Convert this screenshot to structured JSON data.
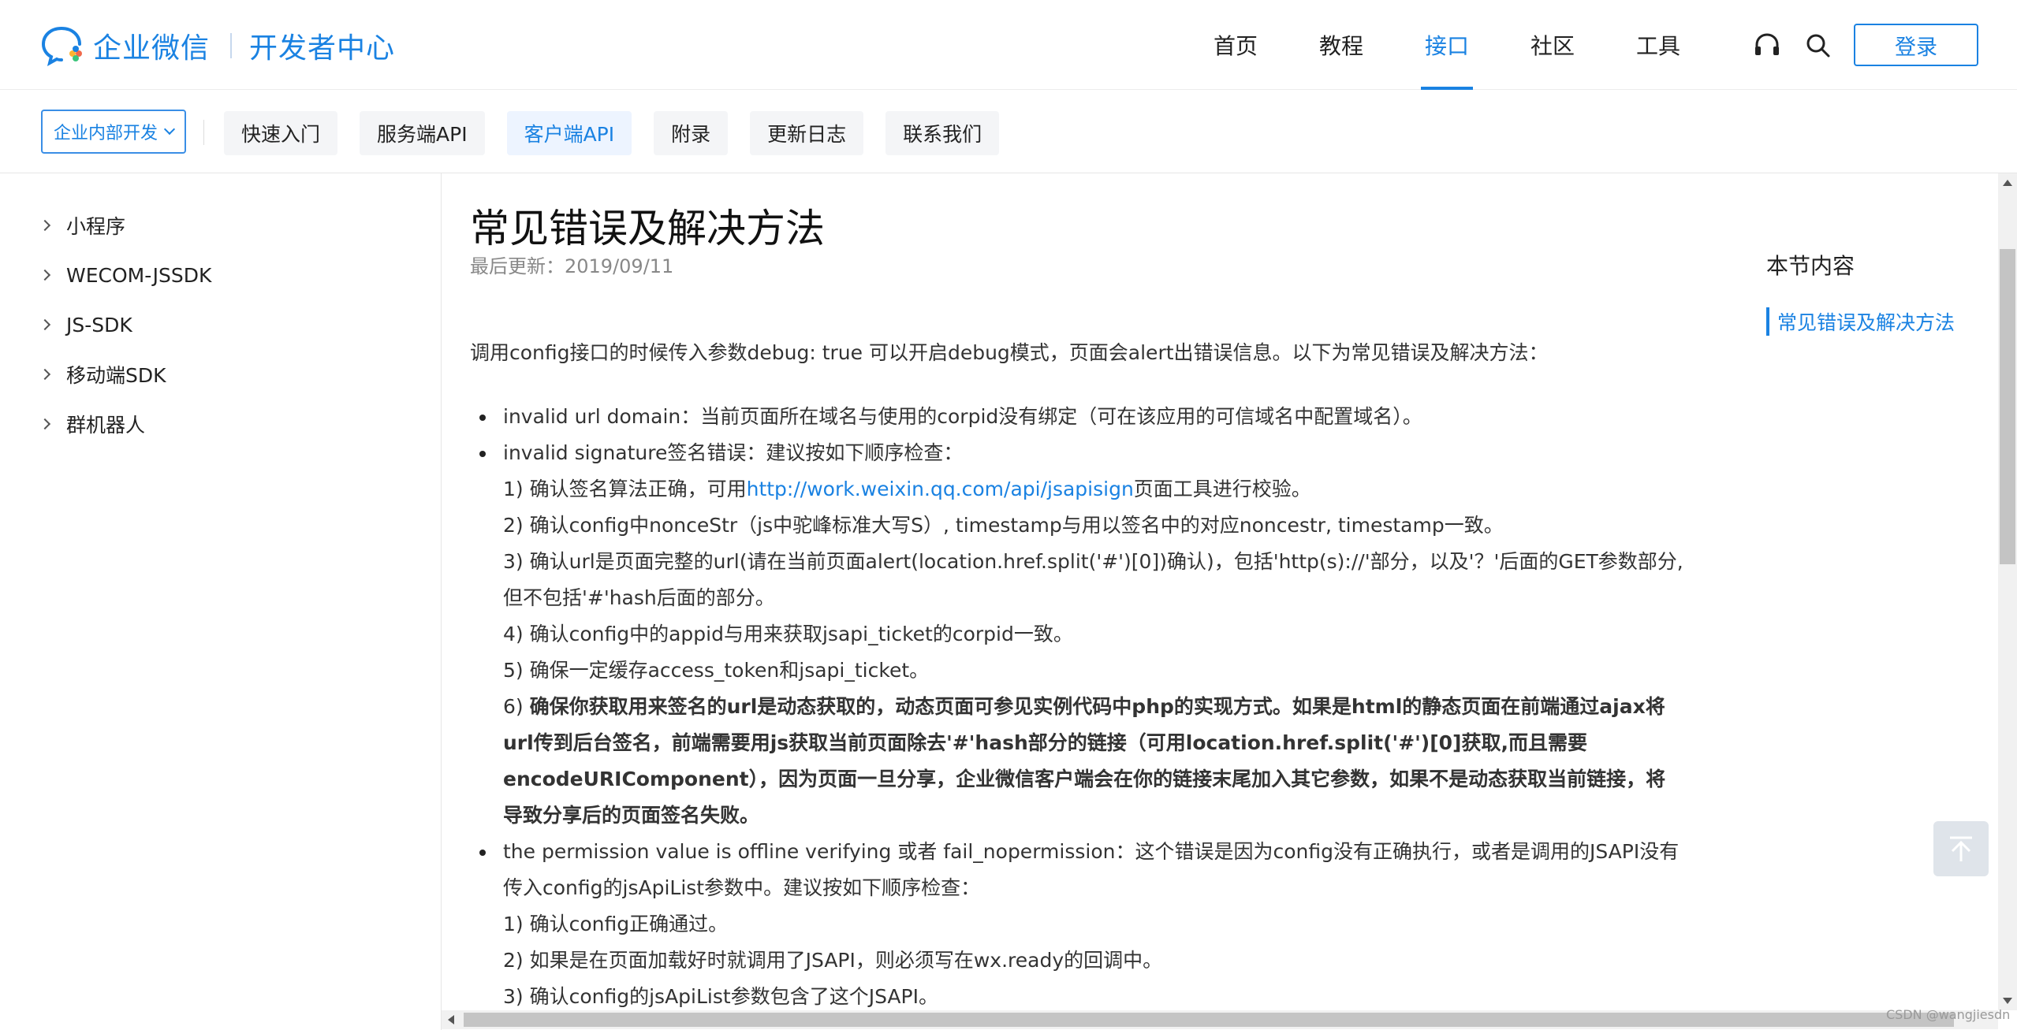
{
  "header": {
    "brand": "企业微信",
    "subtitle": "开发者中心",
    "nav": [
      {
        "label": "首页",
        "active": false
      },
      {
        "label": "教程",
        "active": false
      },
      {
        "label": "接口",
        "active": true
      },
      {
        "label": "社区",
        "active": false
      },
      {
        "label": "工具",
        "active": false
      }
    ],
    "icons": [
      "headset-icon",
      "search-icon"
    ],
    "login_label": "登录",
    "accent_color": "#1a82e2"
  },
  "subnav": {
    "dropdown_label": "企业内部开发",
    "tabs": [
      {
        "label": "快速入门",
        "active": false
      },
      {
        "label": "服务端API",
        "active": false
      },
      {
        "label": "客户端API",
        "active": true
      },
      {
        "label": "附录",
        "active": false
      },
      {
        "label": "更新日志",
        "active": false
      },
      {
        "label": "联系我们",
        "active": false
      }
    ]
  },
  "sidebar": {
    "items": [
      {
        "label": "小程序"
      },
      {
        "label": "WECOM-JSSDK"
      },
      {
        "label": "JS-SDK"
      },
      {
        "label": "移动端SDK"
      },
      {
        "label": "群机器人"
      }
    ]
  },
  "article": {
    "title": "常见错误及解决方法",
    "last_updated": "最后更新：2019/09/11",
    "intro": "调用config接口的时候传入参数debug: true 可以开启debug模式，页面会alert出错误信息。以下为常见错误及解决方法：",
    "b1": "invalid url domain：当前页面所在域名与使用的corpid没有绑定（可在该应用的可信域名中配置域名）。",
    "b2": "invalid signature签名错误：建议按如下顺序检查：",
    "s1_pre": "1) 确认签名算法正确，可用",
    "s1_link": "http://work.weixin.qq.com/api/jsapisign",
    "s1_post": "页面工具进行校验。",
    "s2": "2) 确认config中nonceStr（js中驼峰标准大写S）, timestamp与用以签名中的对应noncestr, timestamp一致。",
    "s3a": "3) 确认url是页面完整的url(请在当前页面alert(location.href.split('#')[0])确认)，包括'http(s)://'部分，以及'？'后面的GET参数部分,",
    "s3b": "但不包括'#'hash后面的部分。",
    "s4": "4) 确认config中的appid与用来获取jsapi_ticket的corpid一致。",
    "s5": "5) 确保一定缓存access_token和jsapi_ticket。",
    "s6_num": "6) ",
    "s6a": "确保你获取用来签名的url是动态获取的，动态页面可参见实例代码中php的实现方式。如果是html的静态页面在前端通过ajax将",
    "s6b": "url传到后台签名，前端需要用js获取当前页面除去'#'hash部分的链接（可用location.href.split('#')[0]获取,而且需要",
    "s6c": "encodeURIComponent），因为页面一旦分享，企业微信客户端会在你的链接末尾加入其它参数，如果不是动态获取当前链接，将",
    "s6d": "导致分享后的页面签名失败。",
    "b3a": "the permission value is offline verifying 或者 fail_nopermission：这个错误是因为config没有正确执行，或者是调用的JSAPI没有",
    "b3b": "传入config的jsApiList参数中。建议按如下顺序检查：",
    "p1": "1) 确认config正确通过。",
    "p2": "2) 如果是在页面加载好时就调用了JSAPI，则必须写在wx.ready的回调中。",
    "p3": "3) 确认config的jsApiList参数包含了这个JSAPI。"
  },
  "toc": {
    "title": "本节内容",
    "items": [
      {
        "label": "常见错误及解决方法",
        "active": true
      }
    ]
  },
  "watermark": "CSDN @wangjiesdn"
}
